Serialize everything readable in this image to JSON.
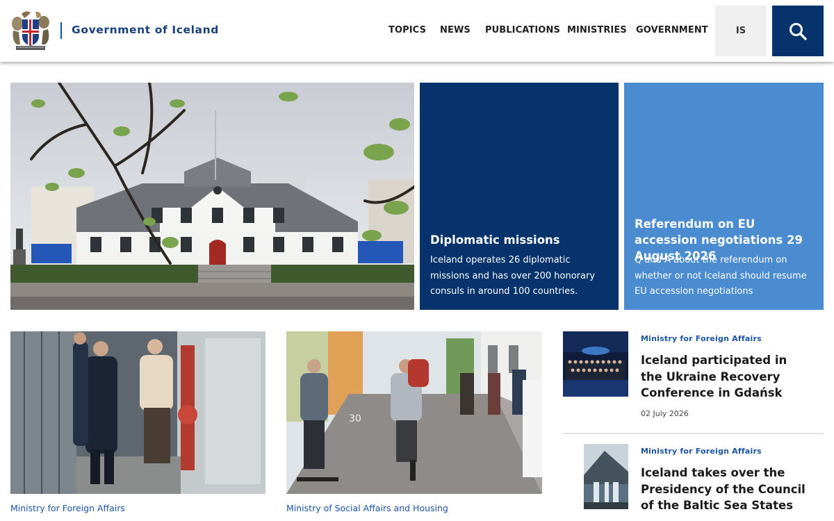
{
  "header": {
    "site_title": "Government of Iceland",
    "nav": [
      "TOPICS",
      "NEWS",
      "PUBLICATIONS",
      "MINISTRIES",
      "GOVERNMENT"
    ],
    "language_button": "IS",
    "search_icon": "search-icon",
    "logo_icon": "coat-of-arms-icon"
  },
  "hero": {
    "image_alt": "Government offices building in Reykjavik",
    "tiles": [
      {
        "title": "Diplomatic missions",
        "text": "Iceland operates 26 diplomatic missions and has over 200 honorary consuls in around 100 countries."
      },
      {
        "title": "Referendum on EU accession negotiations 29 August 2026",
        "text": "Q and A about the referendum on whether or not Iceland should resume EU accession negotiations"
      }
    ]
  },
  "news_cards": [
    {
      "category": "Ministry for Foreign Affairs"
    },
    {
      "category": "Ministry of Social Affairs and Housing"
    }
  ],
  "side_news": [
    {
      "category": "Ministry for Foreign Affairs",
      "title": "Iceland participated in the Ukraine Recovery Conference in Gdańsk",
      "date": "02 July 2026"
    },
    {
      "category": "Ministry for Foreign Affairs",
      "title": "Iceland takes over the Presidency of the Council of the Baltic Sea States"
    }
  ],
  "colors": {
    "navy": "#06336b",
    "light_blue": "#4b8bd0",
    "link_blue": "#1c55a6"
  }
}
